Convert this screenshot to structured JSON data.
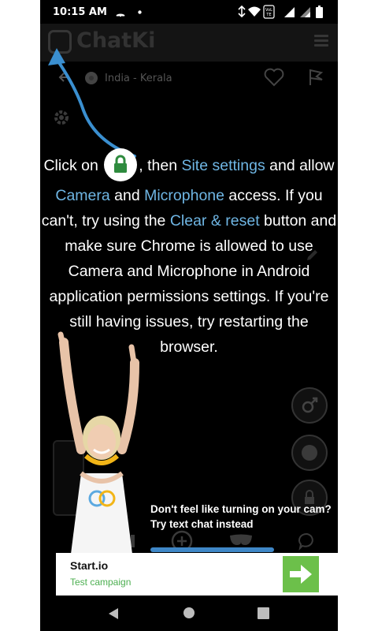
{
  "status_bar": {
    "time": "10:15 AM",
    "icons": [
      "cast-icon",
      "dot-icon",
      "vibrate-icon",
      "wifi-icon",
      "volte-icon",
      "signal-icon",
      "battery-icon"
    ]
  },
  "header": {
    "app_name": "ChatKi",
    "logo_icon": "chat-logo-icon",
    "menu_icon": "hamburger-menu-icon"
  },
  "background": {
    "location": "India - Kerala",
    "icons": [
      "flag-india-icon",
      "heart-icon",
      "report-flag-icon",
      "settings-gear-icon",
      "gender-icon",
      "globe-icon",
      "lock-icon",
      "pause-icon",
      "add-icon",
      "mask-icon",
      "chat-bubble-icon"
    ]
  },
  "tutorial": {
    "part1": "Click on",
    "part2": ", then",
    "site_settings": "Site settings",
    "part3": "and allow",
    "camera": "Camera",
    "and": "and",
    "microphone": "Microphone",
    "part4": "access. If you can't, try using the",
    "clear_reset": "Clear & reset",
    "part5": "button and make sure Chrome is allowed to use Camera and Microphone in Android application permissions settings. If you're still having issues, try restarting the browser."
  },
  "text_chat_hint": "Don't feel like turning on your cam? Try text chat instead",
  "ad": {
    "title": "Start.io",
    "subtitle": "Test campaign",
    "button_icon": "arrow-right-icon"
  },
  "colors": {
    "accent_blue": "#6fb6e4",
    "lock_green": "#2e8b3e",
    "ad_green": "#6cc04a",
    "ad_sub_green": "#4caf50",
    "arrow_blue": "#3a8fd0"
  },
  "navbar": {
    "icons": [
      "back-icon",
      "home-icon",
      "recents-icon"
    ]
  }
}
